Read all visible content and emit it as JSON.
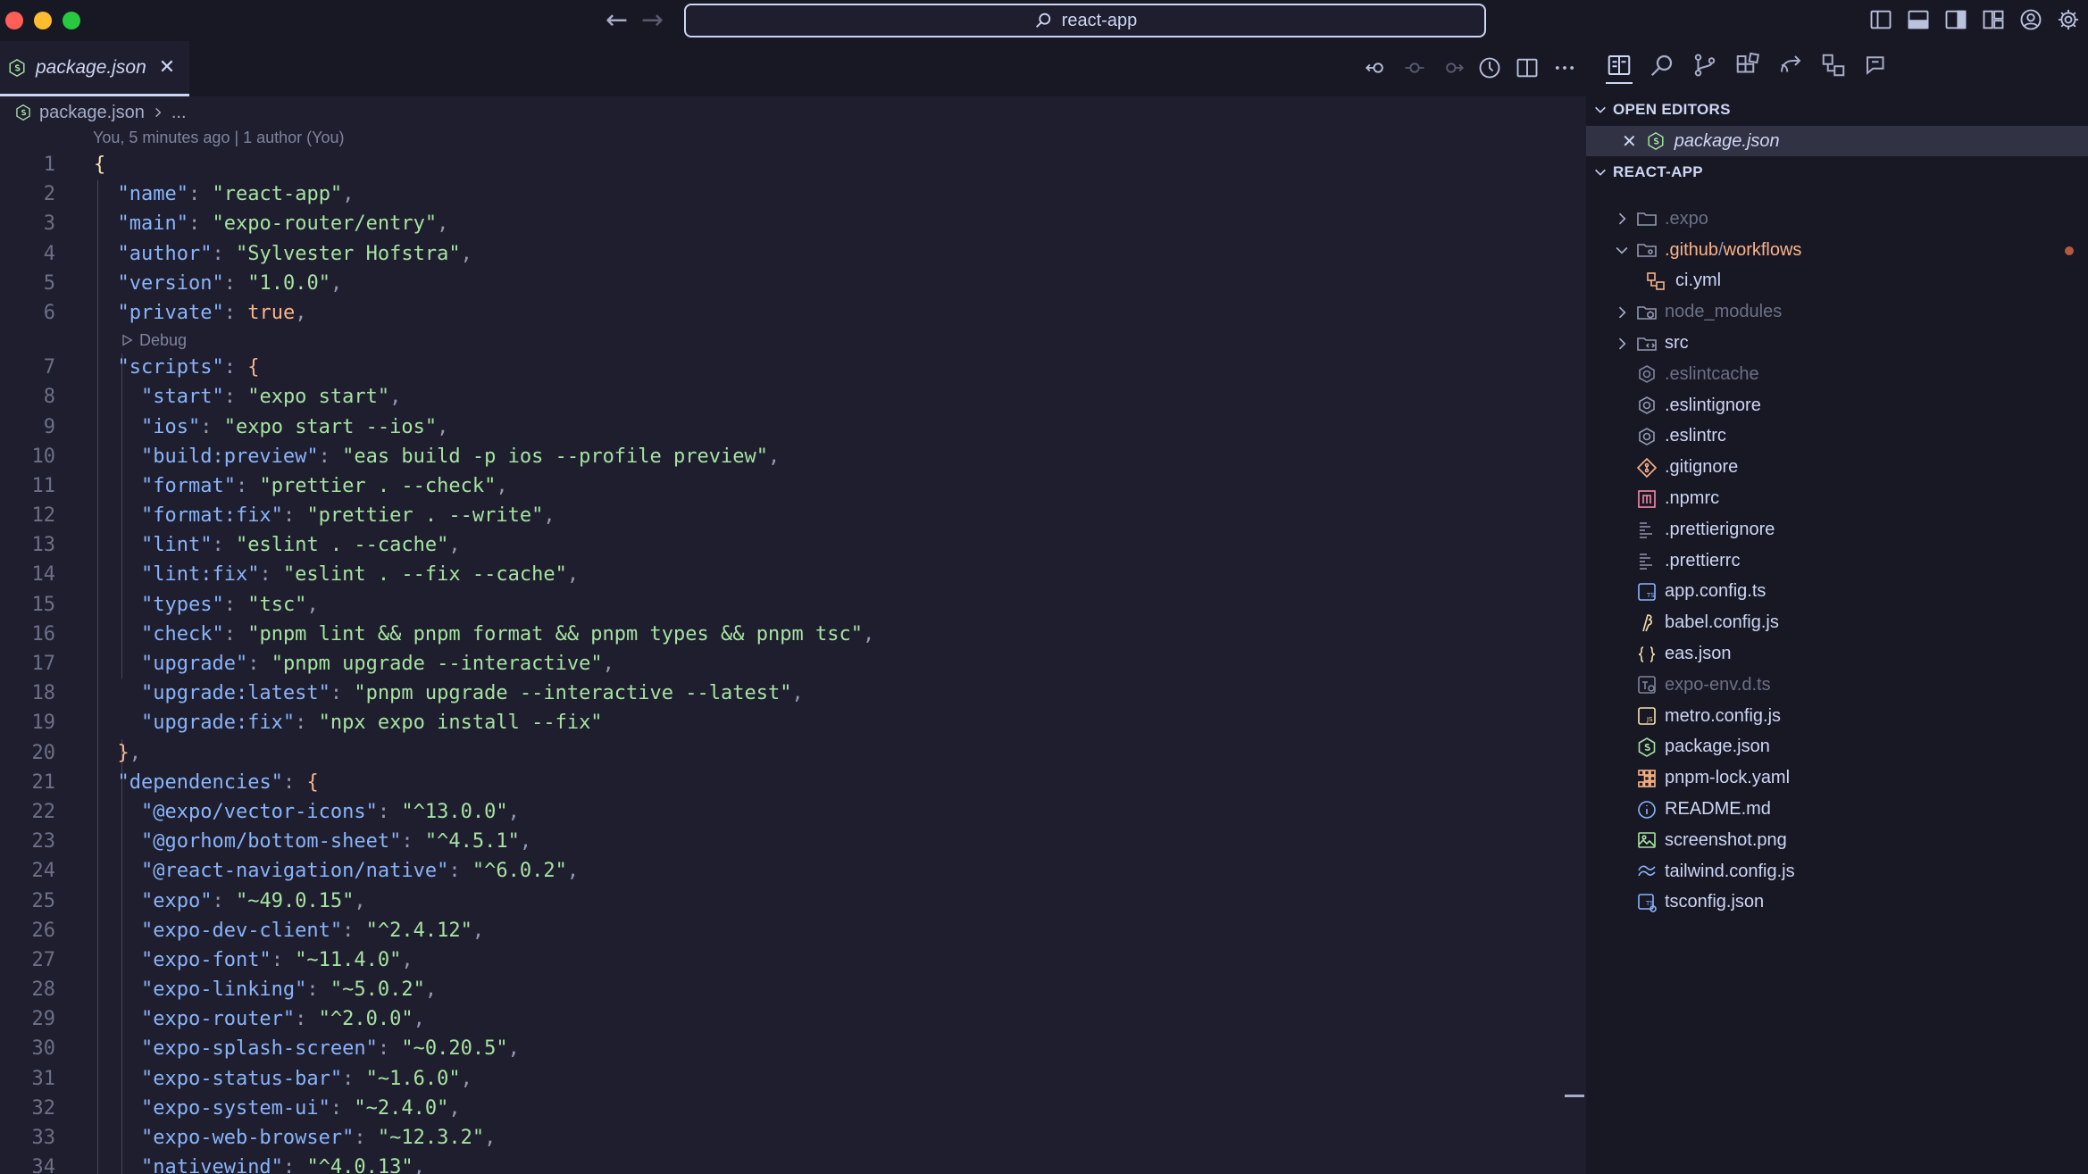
{
  "titlebar": {
    "search_text": "react-app"
  },
  "tab": {
    "label": "package.json",
    "close": "✕"
  },
  "breadcrumb": {
    "file": "package.json",
    "rest": "..."
  },
  "blame": "You, 5 minutes ago | 1 author (You)",
  "codelens": "Debug",
  "code_lines": [
    {
      "n": "1"
    },
    {
      "n": "2"
    },
    {
      "n": "3"
    },
    {
      "n": "4"
    },
    {
      "n": "5"
    },
    {
      "n": "6"
    },
    {
      "n": "7"
    },
    {
      "n": "8"
    },
    {
      "n": "9"
    },
    {
      "n": "10"
    },
    {
      "n": "11"
    },
    {
      "n": "12"
    },
    {
      "n": "13"
    },
    {
      "n": "14"
    },
    {
      "n": "15"
    },
    {
      "n": "16"
    },
    {
      "n": "17"
    },
    {
      "n": "18"
    },
    {
      "n": "19"
    },
    {
      "n": "20"
    },
    {
      "n": "21"
    },
    {
      "n": "22"
    },
    {
      "n": "23"
    },
    {
      "n": "24"
    },
    {
      "n": "25"
    },
    {
      "n": "26"
    },
    {
      "n": "27"
    },
    {
      "n": "28"
    },
    {
      "n": "29"
    },
    {
      "n": "30"
    },
    {
      "n": "31"
    },
    {
      "n": "32"
    },
    {
      "n": "33"
    },
    {
      "n": "34"
    }
  ],
  "pkg": {
    "name_key": "\"name\"",
    "name_val": "\"react-app\"",
    "main_key": "\"main\"",
    "main_val": "\"expo-router/entry\"",
    "author_key": "\"author\"",
    "author_val": "\"Sylvester Hofstra\"",
    "version_key": "\"version\"",
    "version_val": "\"1.0.0\"",
    "private_key": "\"private\"",
    "private_val": "true",
    "scripts_key": "\"scripts\"",
    "scripts": [
      {
        "k": "\"start\"",
        "v": "\"expo start\""
      },
      {
        "k": "\"ios\"",
        "v": "\"expo start --ios\""
      },
      {
        "k": "\"build:preview\"",
        "v": "\"eas build -p ios --profile preview\""
      },
      {
        "k": "\"format\"",
        "v": "\"prettier . --check\""
      },
      {
        "k": "\"format:fix\"",
        "v": "\"prettier . --write\""
      },
      {
        "k": "\"lint\"",
        "v": "\"eslint . --cache\""
      },
      {
        "k": "\"lint:fix\"",
        "v": "\"eslint . --fix --cache\""
      },
      {
        "k": "\"types\"",
        "v": "\"tsc\""
      },
      {
        "k": "\"check\"",
        "v": "\"pnpm lint && pnpm format && pnpm types && pnpm tsc\""
      },
      {
        "k": "\"upgrade\"",
        "v": "\"pnpm upgrade --interactive\""
      },
      {
        "k": "\"upgrade:latest\"",
        "v": "\"pnpm upgrade --interactive --latest\""
      },
      {
        "k": "\"upgrade:fix\"",
        "v": "\"npx expo install --fix\""
      }
    ],
    "deps_key": "\"dependencies\"",
    "deps": [
      {
        "k": "\"@expo/vector-icons\"",
        "v": "\"^13.0.0\""
      },
      {
        "k": "\"@gorhom/bottom-sheet\"",
        "v": "\"^4.5.1\""
      },
      {
        "k": "\"@react-navigation/native\"",
        "v": "\"^6.0.2\""
      },
      {
        "k": "\"expo\"",
        "v": "\"~49.0.15\""
      },
      {
        "k": "\"expo-dev-client\"",
        "v": "\"^2.4.12\""
      },
      {
        "k": "\"expo-font\"",
        "v": "\"~11.4.0\""
      },
      {
        "k": "\"expo-linking\"",
        "v": "\"~5.0.2\""
      },
      {
        "k": "\"expo-router\"",
        "v": "\"^2.0.0\""
      },
      {
        "k": "\"expo-splash-screen\"",
        "v": "\"~0.20.5\""
      },
      {
        "k": "\"expo-status-bar\"",
        "v": "\"~1.6.0\""
      },
      {
        "k": "\"expo-system-ui\"",
        "v": "\"~2.4.0\""
      },
      {
        "k": "\"expo-web-browser\"",
        "v": "\"~12.3.2\""
      },
      {
        "k": "\"nativewind\"",
        "v": "\"^4.0.13\""
      }
    ]
  },
  "sidebar": {
    "open_editors_header": "OPEN EDITORS",
    "open_editor_file": "package.json",
    "project_header": "REACT-APP",
    "tree": [
      {
        "name": ".expo",
        "icon": "folder-icon"
      },
      {
        "name": ".github",
        "sep": "/",
        "name2": "workflows",
        "icon": "folder-git-icon"
      },
      {
        "name": "ci.yml",
        "icon": "workflow-icon"
      },
      {
        "name": "node_modules",
        "icon": "folder-node-icon"
      },
      {
        "name": "src",
        "icon": "folder-src-icon"
      },
      {
        "name": ".eslintcache",
        "icon": "eslint-icon"
      },
      {
        "name": ".eslintignore",
        "icon": "eslint-icon"
      },
      {
        "name": ".eslintrc",
        "icon": "eslint-icon"
      },
      {
        "name": ".gitignore",
        "icon": "git-icon"
      },
      {
        "name": ".npmrc",
        "icon": "npm-icon"
      },
      {
        "name": ".prettierignore",
        "icon": "prettier-icon"
      },
      {
        "name": ".prettierrc",
        "icon": "prettier-icon"
      },
      {
        "name": "app.config.ts",
        "icon": "typescript-icon"
      },
      {
        "name": "babel.config.js",
        "icon": "babel-icon"
      },
      {
        "name": "eas.json",
        "icon": "json-icon"
      },
      {
        "name": "expo-env.d.ts",
        "icon": "typescript-def-icon"
      },
      {
        "name": "metro.config.js",
        "icon": "javascript-icon"
      },
      {
        "name": "package.json",
        "icon": "nodejs-icon"
      },
      {
        "name": "pnpm-lock.yaml",
        "icon": "pnpm-icon"
      },
      {
        "name": "README.md",
        "icon": "info-icon"
      },
      {
        "name": "screenshot.png",
        "icon": "image-icon"
      },
      {
        "name": "tailwind.config.js",
        "icon": "tailwind-icon"
      },
      {
        "name": "tsconfig.json",
        "icon": "tsconfig-icon"
      }
    ]
  },
  "colors": {
    "background": "#1e1e2e",
    "sidebar": "#181825",
    "key": "#89b4fa",
    "string": "#a6e3a1",
    "boolean": "#fab387",
    "line_number": "#6c7086",
    "git_modified": "#fab387"
  }
}
